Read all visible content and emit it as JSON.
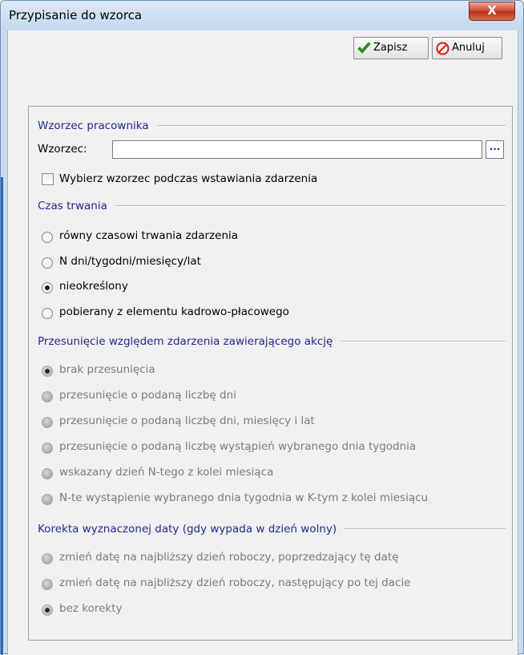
{
  "window": {
    "title": "Przypisanie do wzorca",
    "close_glyph": "X"
  },
  "toolbar": {
    "save_label": "Zapisz",
    "save_icon": "checkmark-icon",
    "save_color": "#2e9a1e",
    "cancel_label": "Anuluj",
    "cancel_icon": "cancel-icon",
    "cancel_color": "#d62a1e"
  },
  "pattern_group": {
    "title": "Wzorzec pracownika",
    "field_label": "Wzorzec:",
    "field_value": "",
    "browse_label": "...",
    "checkbox_label": "Wybierz wzorzec podczas wstawiania zdarzenia",
    "checkbox_checked": false
  },
  "duration_group": {
    "title": "Czas trwania",
    "options": [
      {
        "label": "równy czasowi trwania zdarzenia",
        "selected": false
      },
      {
        "label": "N dni/tygodni/miesięcy/lat",
        "selected": false
      },
      {
        "label": "nieokreślony",
        "selected": true
      },
      {
        "label": "pobierany z elementu kadrowo-płacowego",
        "selected": false
      }
    ]
  },
  "shift_group": {
    "title": "Przesunięcie względem zdarzenia zawierającego akcję",
    "enabled": false,
    "options": [
      {
        "label": "brak przesunięcia",
        "selected": true
      },
      {
        "label": "przesunięcie o podaną liczbę dni",
        "selected": false
      },
      {
        "label": "przesunięcie o podaną liczbę dni, miesięcy i lat",
        "selected": false
      },
      {
        "label": "przesunięcie o podaną liczbę wystąpień wybranego dnia tygodnia",
        "selected": false
      },
      {
        "label": "wskazany dzień N-tego z kolei miesiąca",
        "selected": false
      },
      {
        "label": "N-te wystąpienie wybranego dnia tygodnia w K-tym z kolei miesiącu",
        "selected": false
      }
    ]
  },
  "correction_group": {
    "title": "Korekta wyznaczonej daty (gdy wypada w dzień wolny)",
    "enabled": false,
    "options": [
      {
        "label": "zmień datę na najbliższy dzień roboczy, poprzedzający tę datę",
        "selected": false
      },
      {
        "label": "zmień datę na najbliższy dzień roboczy, następujący po tej dacie",
        "selected": false
      },
      {
        "label": "bez korekty",
        "selected": true
      }
    ]
  }
}
